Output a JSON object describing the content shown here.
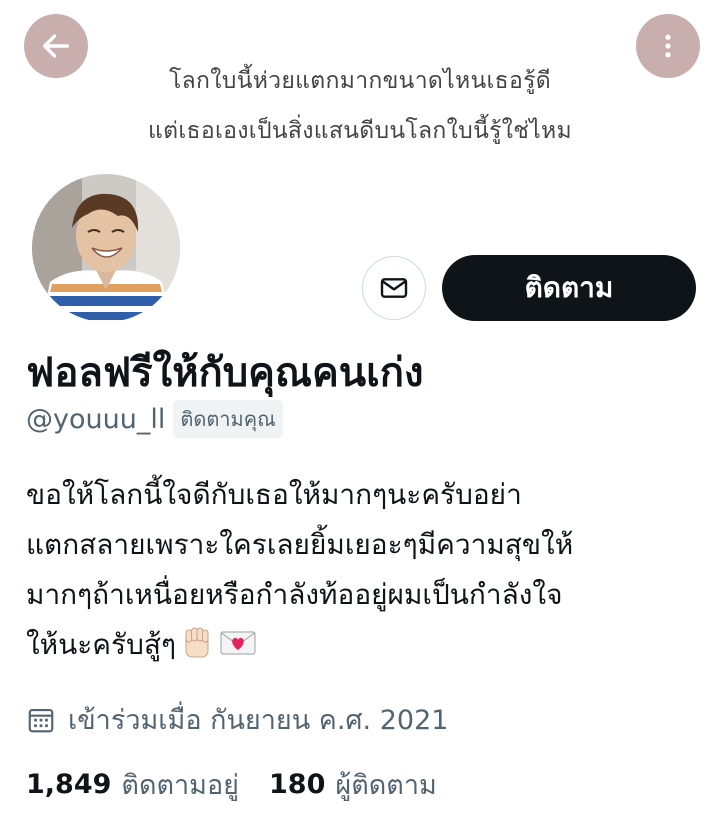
{
  "banner": {
    "line1": "โลกใบนี้ห่วยแตกมากขนาดไหนเธอรู้ดี",
    "line2": "แต่เธอเองเป็นสิ่งแสนดีบนโลกใบนี้รู้ใช่ไหม"
  },
  "actions": {
    "follow_label": "ติดตาม"
  },
  "profile": {
    "display_name": "ฟอลฟรีให้กับคุณคนเก่ง",
    "handle": "@youuu_ll",
    "follows_you_badge": "ติดตามคุณ",
    "bio_lines": [
      "ขอให้โลกนี้ใจดีกับเธอให้มากๆนะครับอย่า",
      "แตกสลายเพราะใครเลยยิ้มเยอะๆมีความสุขให้",
      "มากๆถ้าเหนื่อยหรือกำลังท้ออยู่ผมเป็นกำลังใจ",
      "ให้นะครับสู้ๆ"
    ],
    "joined": "เข้าร่วมเมื่อ กันยายน ค.ศ. 2021"
  },
  "stats": {
    "following_count": "1,849",
    "following_label": "ติดตามอยู่",
    "followers_count": "180",
    "followers_label": "ผู้ติดตาม"
  },
  "icons": {
    "back": "arrow-left-icon",
    "more": "more-vertical-icon",
    "message": "envelope-icon",
    "calendar": "calendar-icon",
    "fist": "raised-fist-emoji",
    "love_letter": "love-letter-emoji"
  },
  "colors": {
    "overlay_button": "#c9aeae",
    "primary_button": "#0f1419",
    "secondary_text": "#536471"
  }
}
